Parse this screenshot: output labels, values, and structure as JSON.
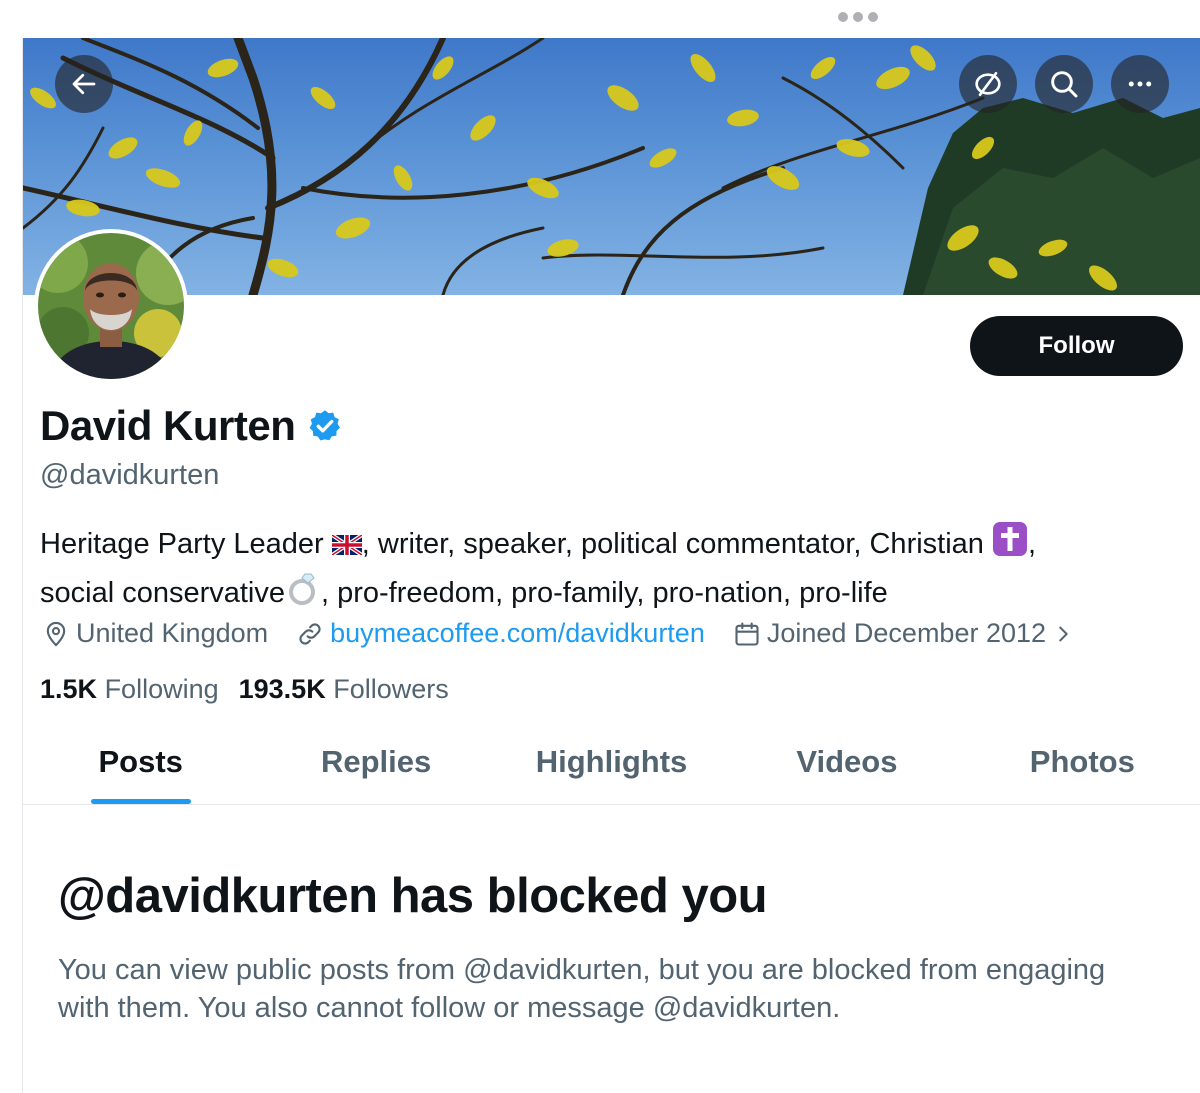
{
  "window": {
    "menu_dots_icon": "more-dots-icon"
  },
  "header": {
    "back_icon": "arrow-left-icon",
    "actions": [
      "eye-off-icon",
      "search-icon",
      "more-horizontal-icon"
    ]
  },
  "profile": {
    "name": "David Kurten",
    "verified": true,
    "verified_color": "#1d9bf0",
    "handle": "@davidkurten",
    "follow_label": "Follow",
    "bio_part1": "Heritage Party Leader ",
    "bio_part2": ", writer, speaker, political commentator, Christian ",
    "bio_part3": ",",
    "bio_part4": "social conservative",
    "bio_part5": ", pro-freedom, pro-family, pro-nation, pro-life",
    "bio_emojis": [
      "uk-flag-emoji",
      "latin-cross-emoji",
      "ring-emoji"
    ],
    "location": "United Kingdom",
    "website": "buymeacoffee.com/davidkurten",
    "joined": "Joined December 2012",
    "following_count": "1.5K",
    "following_label": "Following",
    "followers_count": "193.5K",
    "followers_label": "Followers"
  },
  "tabs": [
    {
      "label": "Posts",
      "active": true
    },
    {
      "label": "Replies",
      "active": false
    },
    {
      "label": "Highlights",
      "active": false
    },
    {
      "label": "Videos",
      "active": false
    },
    {
      "label": "Photos",
      "active": false
    }
  ],
  "blocked": {
    "title": "@davidkurten has blocked you",
    "body": "You can view public posts from @davidkurten, but you are blocked from engaging with them. You also cannot follow or message @davidkurten."
  },
  "colors": {
    "accent": "#1d9bf0",
    "text": "#0f1419",
    "secondary": "#536471",
    "button": "#0f1419"
  }
}
